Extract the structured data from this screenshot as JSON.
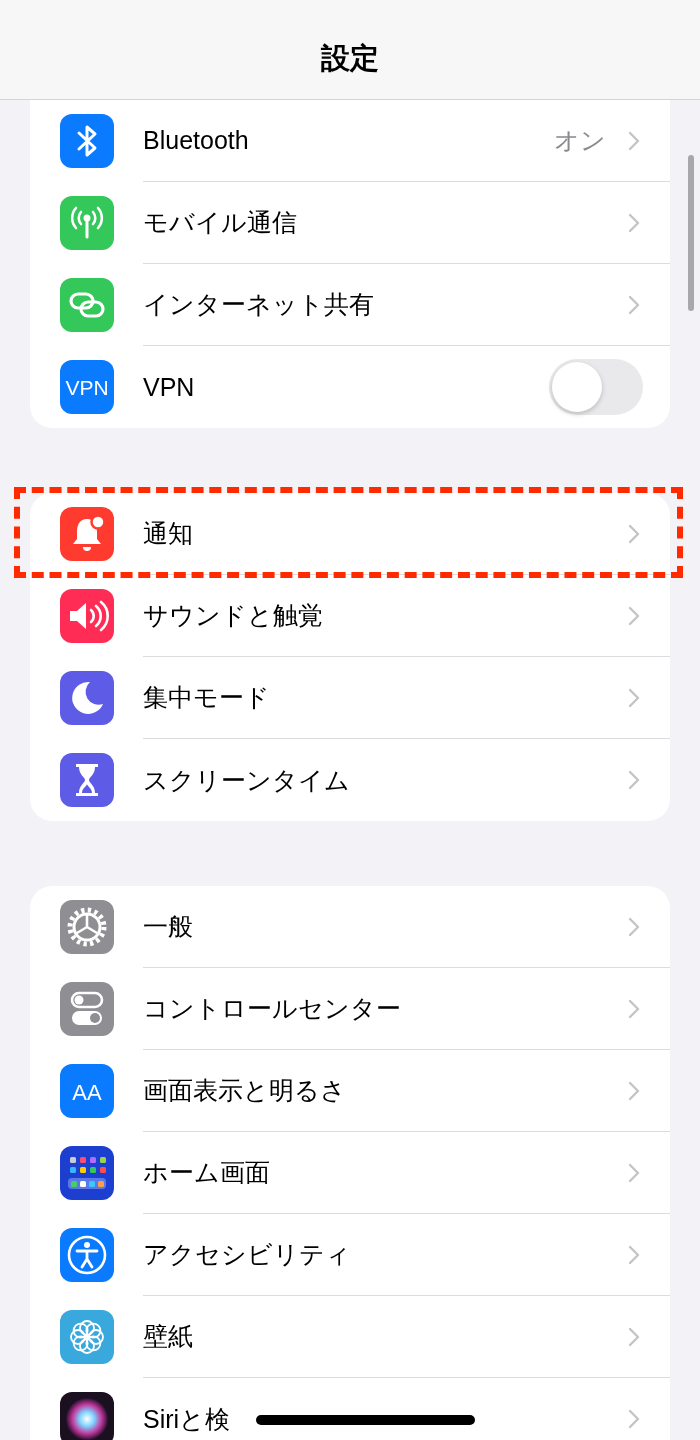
{
  "header": {
    "title": "設定"
  },
  "sections": [
    {
      "items": [
        {
          "label": "Bluetooth",
          "kind": "link",
          "value": "オン",
          "highlighted": false
        },
        {
          "label": "モバイル通信",
          "kind": "link",
          "highlighted": false
        },
        {
          "label": "インターネット共有",
          "kind": "link",
          "highlighted": false
        },
        {
          "label": "VPN",
          "kind": "toggle",
          "on": false,
          "icon_text": "VPN",
          "highlighted": false
        }
      ]
    },
    {
      "items": [
        {
          "label": "通知",
          "kind": "link",
          "highlighted": true
        },
        {
          "label": "サウンドと触覚",
          "kind": "link",
          "highlighted": false
        },
        {
          "label": "集中モード",
          "kind": "link",
          "highlighted": false
        },
        {
          "label": "スクリーンタイム",
          "kind": "link",
          "highlighted": false
        }
      ]
    },
    {
      "items": [
        {
          "label": "一般",
          "kind": "link",
          "highlighted": false
        },
        {
          "label": "コントロールセンター",
          "kind": "link",
          "highlighted": false
        },
        {
          "label": "画面表示と明るさ",
          "kind": "link",
          "icon_text": "AA",
          "highlighted": false
        },
        {
          "label": "ホーム画面",
          "kind": "link",
          "highlighted": false
        },
        {
          "label": "アクセシビリティ",
          "kind": "link",
          "highlighted": false
        },
        {
          "label": "壁紙",
          "kind": "link",
          "highlighted": false
        },
        {
          "label": "Siriと検",
          "kind": "link",
          "highlighted": false
        }
      ]
    }
  ]
}
